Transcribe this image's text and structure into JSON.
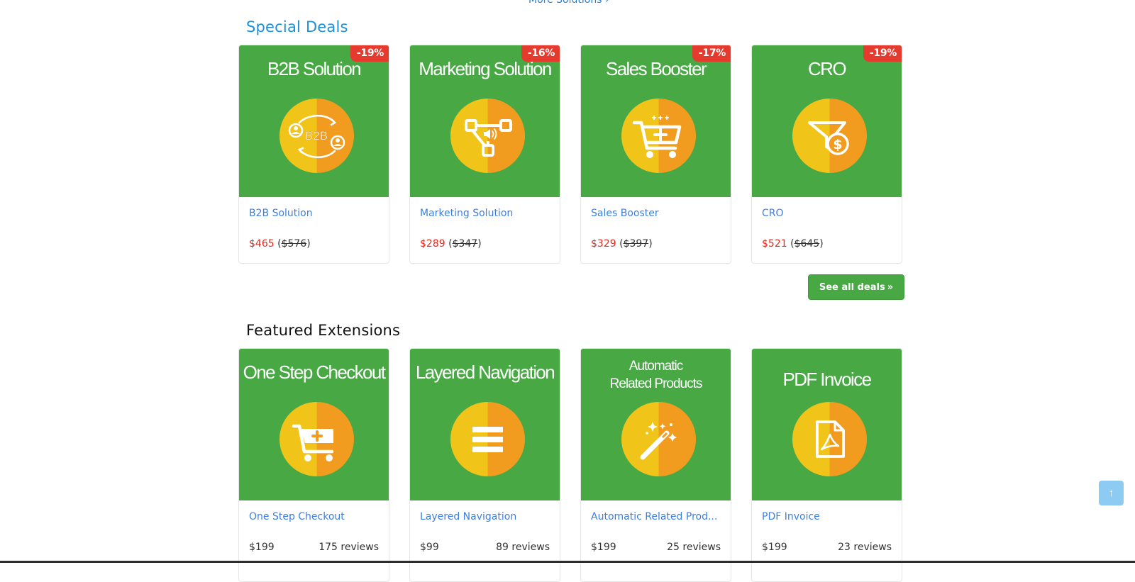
{
  "top": {
    "more_solutions": "More Solutions ›"
  },
  "special_deals": {
    "title": "Special Deals",
    "cards": [
      {
        "banner_title": "B2B Solution",
        "icon": "b2b-icon",
        "discount": "-19%",
        "name": "B2B Solution",
        "price": "$465",
        "old_price": "$576"
      },
      {
        "banner_title": "Marketing Solution",
        "icon": "marketing-icon",
        "discount": "-16%",
        "name": "Marketing Solution",
        "price": "$289",
        "old_price": "$347"
      },
      {
        "banner_title": "Sales Booster",
        "icon": "cart-plus-icon",
        "discount": "-17%",
        "name": "Sales Booster",
        "price": "$329",
        "old_price": "$397"
      },
      {
        "banner_title": "CRO",
        "icon": "funnel-dollar-icon",
        "discount": "-19%",
        "name": "CRO",
        "price": "$521",
        "old_price": "$645"
      }
    ],
    "see_all_label": "See all deals"
  },
  "featured": {
    "title": "Featured Extensions",
    "cards": [
      {
        "banner_title": "One Step Checkout",
        "icon": "cart-plus-icon",
        "name": "One Step Checkout",
        "price": "$199",
        "reviews": "175 reviews"
      },
      {
        "banner_title": "Layered Navigation",
        "icon": "menu-lines-icon",
        "name": "Layered Navigation",
        "price": "$99",
        "reviews": "89 reviews"
      },
      {
        "banner_title_line1": "Automatic",
        "banner_title_line2": "Related Products",
        "icon": "magic-wand-icon",
        "name": "Automatic Related Prod...",
        "price": "$199",
        "reviews": "25 reviews"
      },
      {
        "banner_title": "PDF Invoice",
        "icon": "pdf-file-icon",
        "name": "PDF Invoice",
        "price": "$199",
        "reviews": "23 reviews"
      }
    ]
  },
  "colors": {
    "banner_green": "#47a844",
    "badge_red": "#e53b2f",
    "link_blue": "#3d7fe0",
    "section_blue": "#1e8fd8",
    "circle_yellow": "#f0c419",
    "circle_orange": "#f29c1f",
    "price_red": "#e8271f",
    "scroll_top_blue": "#8ecbf2"
  },
  "scroll_top_icon": "arrow-up-icon"
}
